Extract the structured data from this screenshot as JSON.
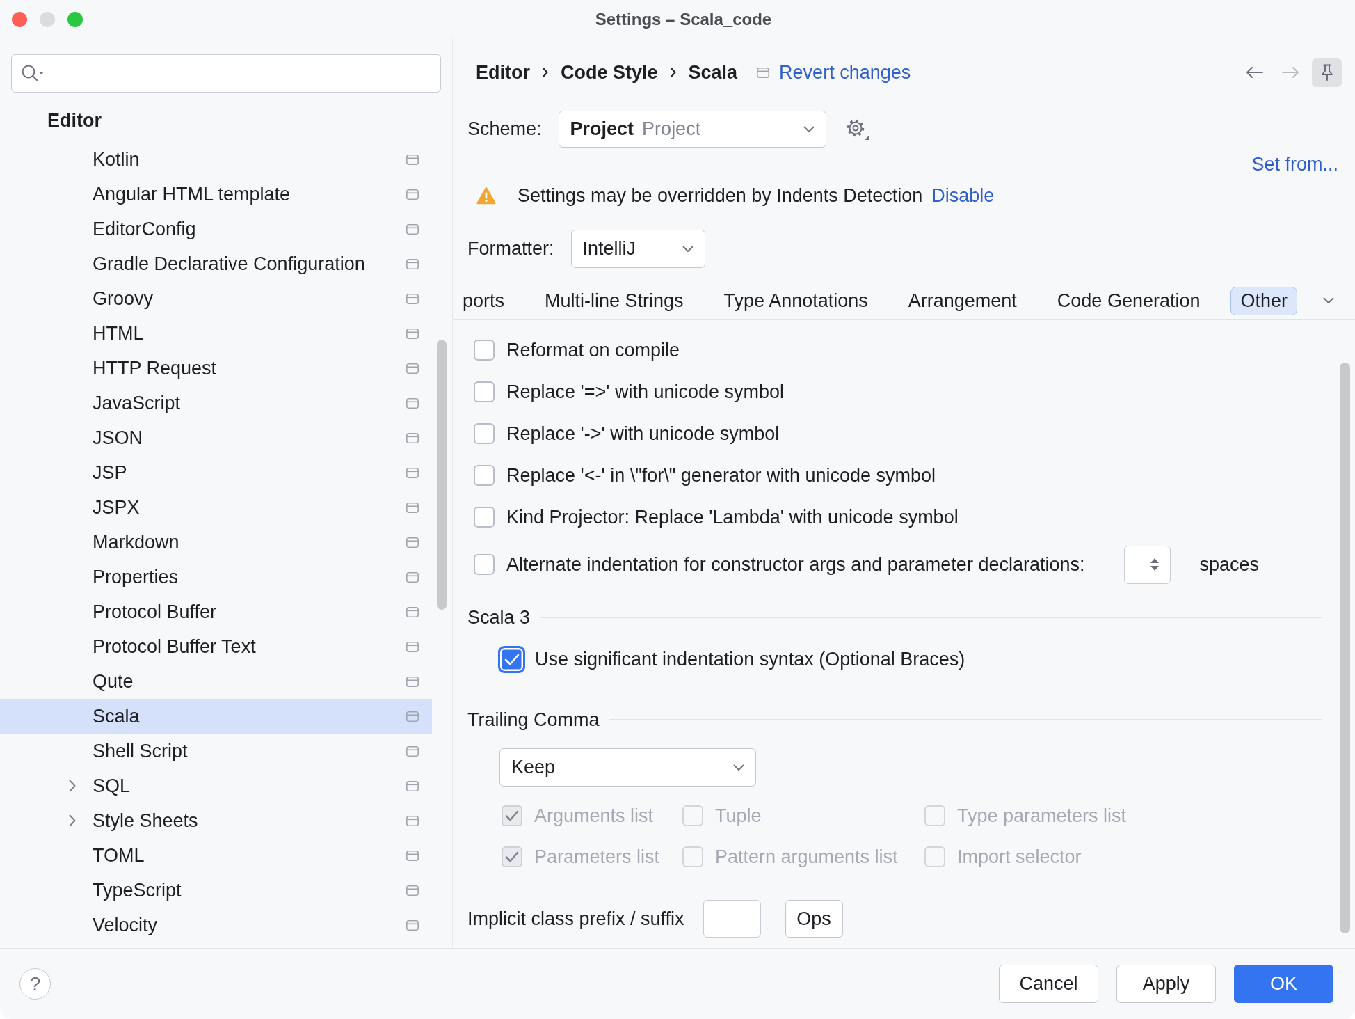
{
  "window": {
    "title": "Settings – Scala_code",
    "controls": [
      {
        "kind": "close",
        "disabled": false
      },
      {
        "kind": "minimize",
        "disabled": true
      },
      {
        "kind": "zoom",
        "disabled": false
      }
    ]
  },
  "sidebar": {
    "heading": "Editor",
    "items": [
      {
        "label": "Kotlin",
        "kind": "page",
        "selected": false
      },
      {
        "label": "Angular HTML template",
        "kind": "page",
        "selected": false
      },
      {
        "label": "EditorConfig",
        "kind": "page",
        "selected": false
      },
      {
        "label": "Gradle Declarative Configuration",
        "kind": "page",
        "selected": false
      },
      {
        "label": "Groovy",
        "kind": "page",
        "selected": false
      },
      {
        "label": "HTML",
        "kind": "page",
        "selected": false
      },
      {
        "label": "HTTP Request",
        "kind": "page",
        "selected": false
      },
      {
        "label": "JavaScript",
        "kind": "page",
        "selected": false
      },
      {
        "label": "JSON",
        "kind": "page",
        "selected": false
      },
      {
        "label": "JSP",
        "kind": "page",
        "selected": false
      },
      {
        "label": "JSPX",
        "kind": "page",
        "selected": false
      },
      {
        "label": "Markdown",
        "kind": "page",
        "selected": false
      },
      {
        "label": "Properties",
        "kind": "page",
        "selected": false
      },
      {
        "label": "Protocol Buffer",
        "kind": "page",
        "selected": false
      },
      {
        "label": "Protocol Buffer Text",
        "kind": "page",
        "selected": false
      },
      {
        "label": "Qute",
        "kind": "page",
        "selected": false
      },
      {
        "label": "Scala",
        "kind": "page",
        "selected": true
      },
      {
        "label": "Shell Script",
        "kind": "page",
        "selected": false
      },
      {
        "label": "SQL",
        "kind": "group",
        "selected": false
      },
      {
        "label": "Style Sheets",
        "kind": "group",
        "selected": false
      },
      {
        "label": "TOML",
        "kind": "page",
        "selected": false
      },
      {
        "label": "TypeScript",
        "kind": "page",
        "selected": false
      },
      {
        "label": "Velocity",
        "kind": "page",
        "selected": false
      }
    ]
  },
  "breadcrumb": [
    "Editor",
    "Code Style",
    "Scala"
  ],
  "revert_link": "Revert changes",
  "navigation": [
    {
      "kind": "back",
      "disabled": false
    },
    {
      "kind": "forward",
      "disabled": true
    }
  ],
  "pin": {
    "selected": true
  },
  "scheme": {
    "label": "Scheme:",
    "value": "Project",
    "detail": "Project"
  },
  "set_from_link": "Set from...",
  "notice": {
    "text": "Settings may be overridden by Indents Detection",
    "link": "Disable"
  },
  "formatter": {
    "label": "Formatter:",
    "value": "IntelliJ"
  },
  "tabs": [
    {
      "label": "ports",
      "selected": false
    },
    {
      "label": "Multi-line Strings",
      "selected": false
    },
    {
      "label": "Type Annotations",
      "selected": false
    },
    {
      "label": "Arrangement",
      "selected": false
    },
    {
      "label": "Code Generation",
      "selected": false
    },
    {
      "label": "Other",
      "selected": true
    }
  ],
  "options": [
    {
      "kind": "checkbox",
      "label": "Reformat on compile",
      "checked": false
    },
    {
      "kind": "checkbox",
      "label": "Replace '=>' with unicode symbol",
      "checked": false
    },
    {
      "kind": "checkbox",
      "label": "Replace '->' with unicode symbol",
      "checked": false
    },
    {
      "kind": "checkbox",
      "label": "Replace '<-' in \\\"for\\\" generator with unicode symbol",
      "checked": false
    },
    {
      "kind": "checkbox",
      "label": "Kind Projector: Replace 'Lambda' with unicode symbol",
      "checked": false
    },
    {
      "kind": "checkbox_spinner",
      "label": "Alternate indentation for constructor args and parameter declarations:",
      "checked": false,
      "unit": "spaces"
    }
  ],
  "scala3": {
    "heading": "Scala 3",
    "options": [
      {
        "label": "Use significant indentation syntax (Optional Braces)",
        "checked": true,
        "focused": true
      }
    ]
  },
  "trailing_comma": {
    "heading": "Trailing Comma",
    "mode": "Keep",
    "options": [
      {
        "label": "Arguments list",
        "checked": true,
        "disabled": true
      },
      {
        "label": "Tuple",
        "checked": false,
        "disabled": true
      },
      {
        "label": "Type parameters list",
        "checked": false,
        "disabled": true
      },
      {
        "label": "Parameters list",
        "checked": true,
        "disabled": true
      },
      {
        "label": "Pattern arguments list",
        "checked": false,
        "disabled": true
      },
      {
        "label": "Import selector",
        "checked": false,
        "disabled": true
      }
    ]
  },
  "implicit_class": {
    "label": "Implicit class prefix / suffix",
    "button": "Ops"
  },
  "footer": {
    "help": "?",
    "buttons": [
      {
        "label": "Cancel",
        "kind": "secondary"
      },
      {
        "label": "Apply",
        "kind": "secondary"
      },
      {
        "label": "OK",
        "kind": "primary"
      }
    ]
  }
}
